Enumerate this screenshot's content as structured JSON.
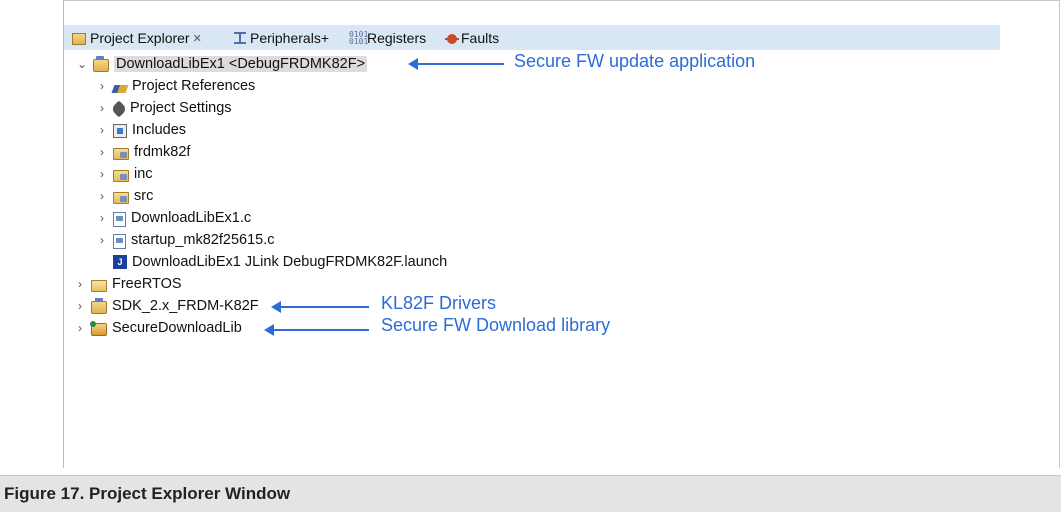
{
  "tabs": [
    {
      "label": "Project Explorer",
      "close": "✕",
      "icon": "project-explorer-icon"
    },
    {
      "label": "Peripherals+",
      "icon": "peripherals-icon"
    },
    {
      "label": "Registers",
      "icon": "registers-icon"
    },
    {
      "label": "Faults",
      "icon": "faults-icon"
    }
  ],
  "tree": {
    "root": {
      "twisty": "⌄",
      "label": "DownloadLibEx1 <DebugFRDMK82F>",
      "icon": "project-icon"
    },
    "children": [
      {
        "twisty": "›",
        "label": "Project References",
        "icon": "project-references-icon"
      },
      {
        "twisty": "›",
        "label": "Project Settings",
        "icon": "project-settings-icon"
      },
      {
        "twisty": "›",
        "label": "Includes",
        "icon": "includes-icon"
      },
      {
        "twisty": "›",
        "label": "frdmk82f",
        "icon": "source-folder-icon"
      },
      {
        "twisty": "›",
        "label": "inc",
        "icon": "source-folder-icon"
      },
      {
        "twisty": "›",
        "label": "src",
        "icon": "source-folder-icon"
      },
      {
        "twisty": "›",
        "label": "DownloadLibEx1.c",
        "icon": "c-file-icon"
      },
      {
        "twisty": "›",
        "label": "startup_mk82f25615.c",
        "icon": "c-file-icon"
      },
      {
        "twisty": "",
        "label": "DownloadLibEx1 JLink DebugFRDMK82F.launch",
        "icon": "launch-config-icon"
      }
    ],
    "siblings": [
      {
        "twisty": "›",
        "label": "FreeRTOS",
        "icon": "freertos-folder-icon"
      },
      {
        "twisty": "›",
        "label": "SDK_2.x_FRDM-K82F",
        "icon": "sdk-project-icon"
      },
      {
        "twisty": "›",
        "label": "SecureDownloadLib",
        "icon": "library-project-icon"
      }
    ]
  },
  "annotations": {
    "app": "Secure FW update application",
    "drivers": "KL82F Drivers",
    "library": "Secure FW Download library"
  },
  "caption": "Figure 17.  Project Explorer Window",
  "colors": {
    "tabbar": "#d9e6f3",
    "annotation": "#2d6bd8",
    "selection": "#dcdcdc"
  }
}
